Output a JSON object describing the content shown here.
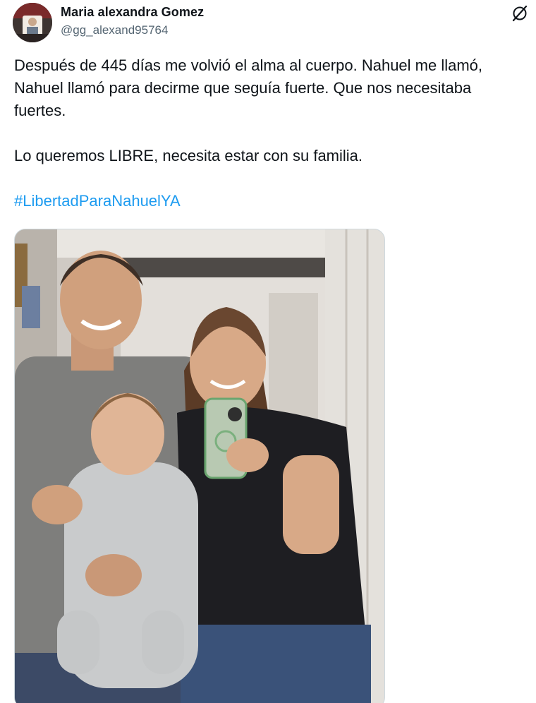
{
  "author": {
    "display_name": "Maria alexandra Gomez",
    "handle": "@gg_alexand95764"
  },
  "header_icon": "grok-icon",
  "tweet": {
    "paragraph_1": "Después de 445 días me volvió el alma al cuerpo. Nahuel me llamó, Nahuel llamó para decirme que seguía fuerte. Que nos necesitaba fuertes.",
    "paragraph_2": "Lo queremos LIBRE, necesita estar con su familia.",
    "hashtag": "#LibertadParaNahuelYA"
  },
  "colors": {
    "link": "#1d9bf0",
    "text": "#0f1419",
    "secondary": "#536471"
  }
}
